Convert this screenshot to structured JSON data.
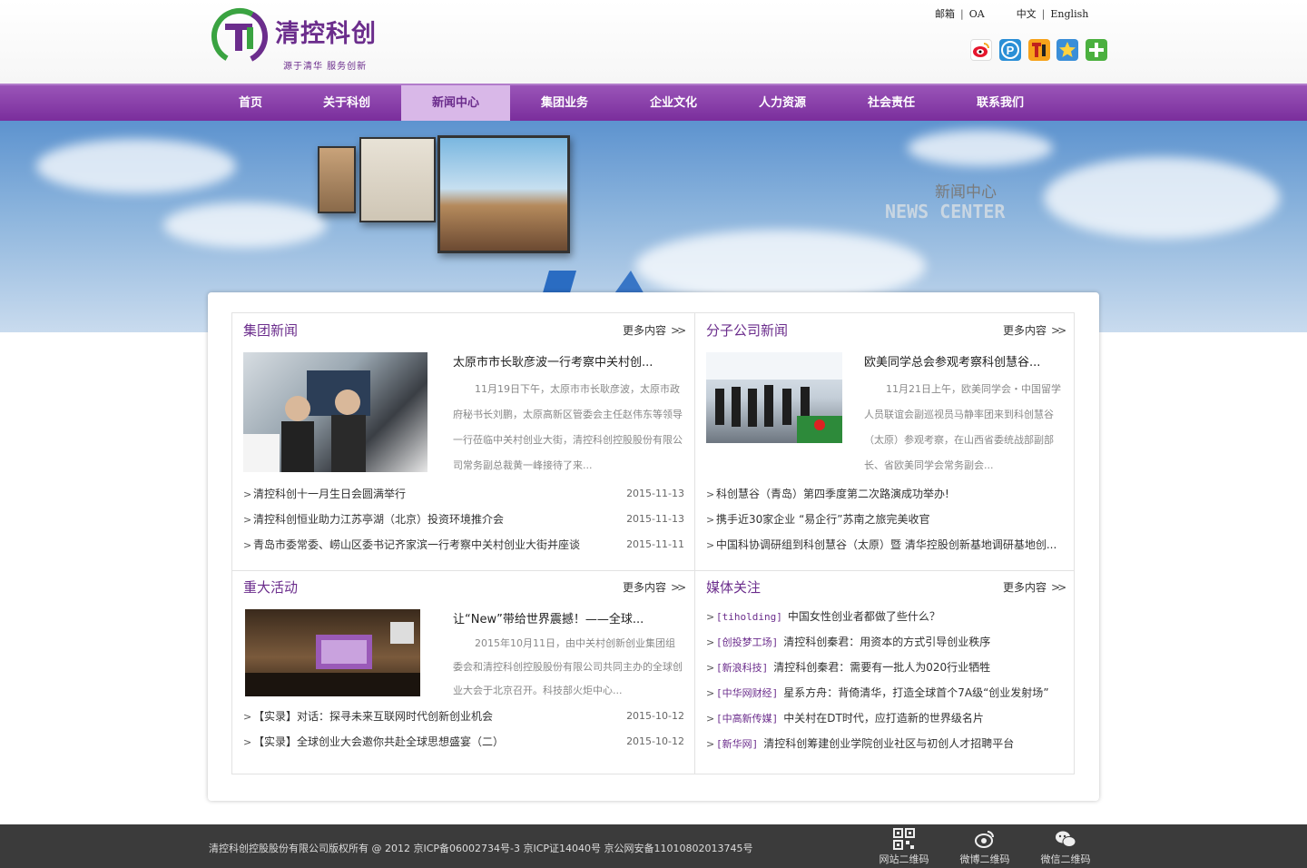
{
  "header": {
    "logo_title": "清控科创",
    "logo_slogan": "源于清华 服务创新",
    "top_links": [
      "邮箱",
      "OA",
      "中文",
      "English"
    ],
    "share_icons": [
      "weibo-icon",
      "pinterest-icon",
      "tencent-weibo-icon",
      "favorite-star-icon",
      "add-plus-icon"
    ]
  },
  "nav": {
    "items": [
      "首页",
      "关于科创",
      "新闻中心",
      "集团业务",
      "企业文化",
      "人力资源",
      "社会责任",
      "联系我们"
    ],
    "active_index": 2
  },
  "banner": {
    "title": "新闻中心",
    "subtitle": "NEWS CENTER"
  },
  "more_label": "更多内容",
  "panels": {
    "group_news": {
      "title": "集团新闻",
      "lead_title": "太原市市长耿彦波一行考察中关村创...",
      "lead_body": "11月19日下午，太原市市长耿彦波，太原市政府秘书长刘鹏，太原高新区管委会主任赵伟东等领导一行莅临中关村创业大街，清控科创控股股份有限公司常务副总裁黄一峰接待了来...",
      "items": [
        {
          "text": "清控科创十一月生日会圆满举行",
          "date": "2015-11-13"
        },
        {
          "text": "清控科创恒业助力江苏亭湖（北京）投资环境推介会",
          "date": "2015-11-13"
        },
        {
          "text": "青岛市委常委、崂山区委书记齐家滨一行考察中关村创业大街并座谈",
          "date": "2015-11-11"
        }
      ]
    },
    "branch_news": {
      "title": "分子公司新闻",
      "lead_title": "欧美同学总会参观考察科创慧谷...",
      "lead_body": "11月21日上午，欧美同学会・中国留学人员联谊会副巡视员马静率团来到科创慧谷（太原）参观考察，在山西省委统战部副部长、省欧美同学会常务副会...",
      "items": [
        {
          "text": "科创慧谷（青岛）第四季度第二次路演成功举办!"
        },
        {
          "text": "携手近30家企业 “易企行”苏南之旅完美收官"
        },
        {
          "text": "中国科协调研组到科创慧谷（太原）暨 清华控股创新基地调研基地创..."
        }
      ]
    },
    "major_events": {
      "title": "重大活动",
      "lead_title": "让“New”带给世界震撼！——全球...",
      "lead_body": "2015年10月11日，由中关村创新创业集团组委会和清控科创控股股份有限公司共同主办的全球创业大会于北京召开。科技部火炬中心...",
      "items": [
        {
          "text": "【实录】对话：探寻未来互联网时代创新创业机会",
          "date": "2015-10-12"
        },
        {
          "text": "【实录】全球创业大会邀你共赴全球思想盛宴（二）",
          "date": "2015-10-12"
        }
      ]
    },
    "media": {
      "title": "媒体关注",
      "items": [
        {
          "source": "[tiholding]",
          "text": "中国女性创业者都做了些什么？"
        },
        {
          "source": "[创投梦工场]",
          "text": "清控科创秦君：用资本的方式引导创业秩序"
        },
        {
          "source": "[新浪科技]",
          "text": "清控科创秦君：需要有一批人为020行业牺牲"
        },
        {
          "source": "[中华网财经]",
          "text": "星系方舟：背倚清华，打造全球首个7A级“创业发射场”"
        },
        {
          "source": "[中高新传媒]",
          "text": "中关村在DT时代，应打造新的世界级名片"
        },
        {
          "source": "[新华网]",
          "text": "清控科创筹建创业学院创业社区与初创人才招聘平台"
        }
      ]
    }
  },
  "footer": {
    "copyright": "清控科创控股股份有限公司版权所有 @ 2012 京ICP备06002734号-3 京ICP证14040号 京公网安备11010802013745号",
    "qr_labels": [
      "网站二维码",
      "微博二维码",
      "微信二维码"
    ]
  },
  "colors": {
    "brand_purple": "#6b2d8c",
    "nav_active": "#d9b8e8",
    "footer_bg": "#3b3b3b"
  }
}
